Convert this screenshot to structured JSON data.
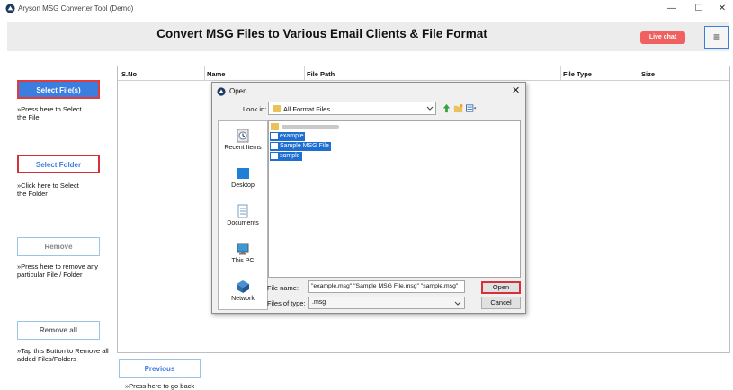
{
  "window": {
    "title": "Aryson MSG Converter Tool (Demo)",
    "minimize": "—",
    "maximize": "☐",
    "close": "✕"
  },
  "header": {
    "title": "Convert MSG Files to Various Email Clients & File Format",
    "live_chat": "Live chat",
    "menu_icon": "≡"
  },
  "sidebar": {
    "select_files": {
      "label": "Select File(s)",
      "desc_1": "»Press here to Select",
      "desc_2": "the File"
    },
    "select_folder": {
      "label": "Select Folder",
      "desc_1": "»Click here to Select",
      "desc_2": "the Folder"
    },
    "remove": {
      "label": "Remove",
      "desc_1": "»Press here to remove any",
      "desc_2": "particular File / Folder"
    },
    "remove_all": {
      "label": "Remove all",
      "desc_1": "»Tap this Button to Remove all",
      "desc_2": "added Files/Folders"
    },
    "previous": {
      "label": "Previous",
      "desc_1": "»Press here to go back"
    }
  },
  "table": {
    "columns": [
      "S.No",
      "Name",
      "File Path",
      "File Type",
      "Size"
    ]
  },
  "dialog": {
    "title": "Open",
    "close": "✕",
    "look_in_label": "Look in:",
    "look_in_value": "All Format Files",
    "places": [
      "Recent Items",
      "Desktop",
      "Documents",
      "This PC",
      "Network"
    ],
    "files": [
      "example",
      "Sample MSG File",
      "sample"
    ],
    "file_name_label": "File name:",
    "file_name_value": "\"example.msg\" \"Sample MSG File.msg\" \"sample.msg\"",
    "file_type_label": "Files of type:",
    "file_type_value": ".msg",
    "open_label": "Open",
    "cancel_label": "Cancel"
  },
  "colors": {
    "accent_blue": "#3c7ee0",
    "highlight_red": "#d6303a",
    "live_chat": "#f06060",
    "selection": "#1f6fd0"
  }
}
